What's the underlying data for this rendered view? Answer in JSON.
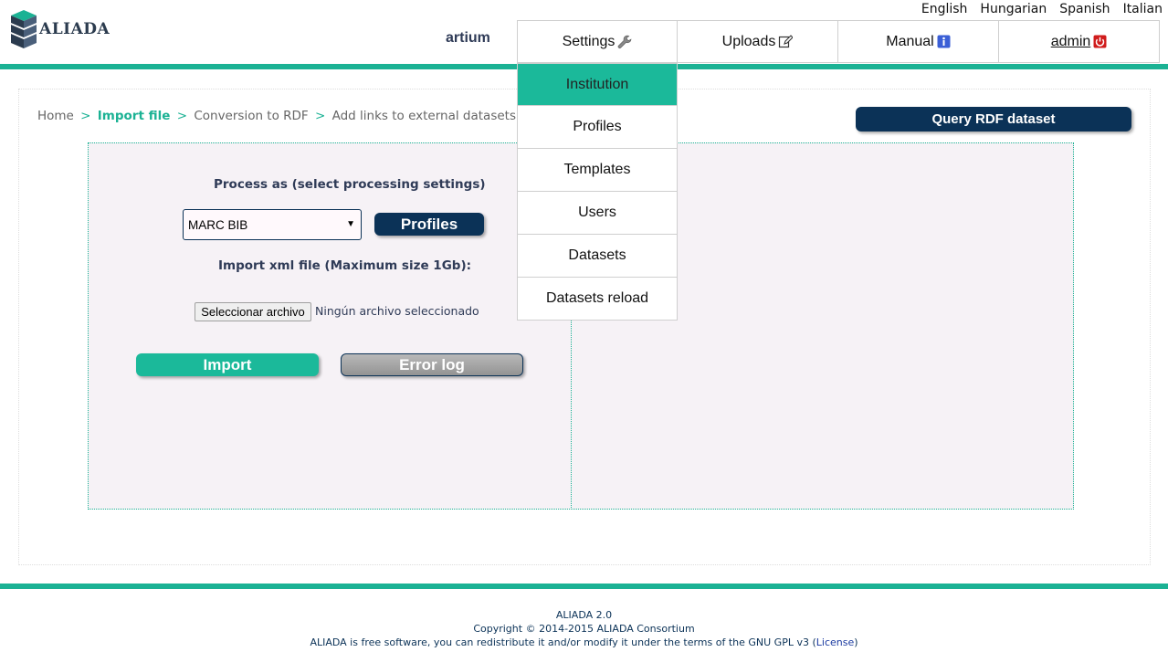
{
  "languages": [
    "English",
    "Hungarian",
    "Spanish",
    "Italian"
  ],
  "brand": {
    "name": "ALIADA"
  },
  "user": {
    "name": "artium"
  },
  "nav": {
    "settings": {
      "label": "Settings",
      "icon": "wrench-icon"
    },
    "uploads": {
      "label": "Uploads",
      "icon": "edit-icon"
    },
    "manual": {
      "label": "Manual",
      "icon": "info-icon"
    },
    "admin": {
      "label": "admin",
      "icon": "power-icon"
    }
  },
  "settings_menu": [
    "Institution",
    "Profiles",
    "Templates",
    "Users",
    "Datasets",
    "Datasets reload"
  ],
  "breadcrumb": {
    "home": "Home",
    "import": "Import file",
    "conversion": "Conversion to RDF",
    "links": "Add links to external datasets",
    "separator": ">"
  },
  "query_button": "Query RDF dataset",
  "form": {
    "process_label": "Process as (select processing settings)",
    "process_value": "MARC BIB",
    "profiles_button": "Profiles",
    "import_label": "Import xml file (Maximum size 1Gb):",
    "file_button": "Seleccionar archivo",
    "file_status": "Ningún archivo seleccionado",
    "import_button": "Import",
    "error_log_button": "Error log"
  },
  "footer": {
    "version": "ALIADA 2.0",
    "copyright": "Copyright © 2014-2015 ALIADA Consortium",
    "license_text": "ALIADA is free software, you can redistribute it and/or modify it under the terms of the GNU GPL v3 (",
    "license_link": "License",
    "license_end": ")"
  },
  "colors": {
    "accent": "#1bb294",
    "dark_button": "#0b3257",
    "panel_bg": "#f6f2f6"
  }
}
